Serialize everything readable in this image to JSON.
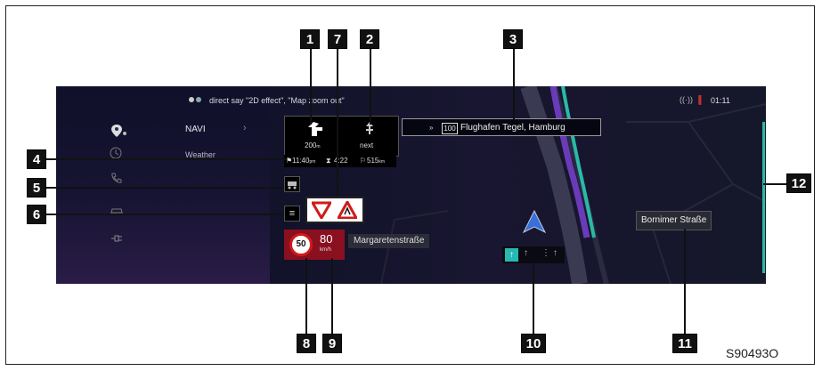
{
  "status": {
    "voice_hint": "direct say \"2D effect\", \"Map zoom out\"",
    "time": "01:11"
  },
  "sidebar": {
    "navi_label": "NAVI",
    "weather_label": "Weather",
    "icons": [
      "map-pin-icon",
      "clock-icon",
      "phone-icon",
      "car-icon",
      "plug-icon"
    ]
  },
  "maneuver": {
    "distance": "200",
    "distance_unit": "m",
    "next_label": "next"
  },
  "destination": {
    "road_badge": "100",
    "text": "Flughafen Tegel, Hamburg"
  },
  "trip": {
    "arrival": "11:40",
    "arrival_suffix": "pm",
    "duration": "4:22",
    "distance": "515",
    "distance_unit": "km"
  },
  "speed": {
    "limit": "50",
    "current": "80",
    "unit": "km/h"
  },
  "current_street": "Margaretenstraße",
  "cross_street": "Bornimer Straße",
  "callouts": [
    "1",
    "2",
    "3",
    "4",
    "5",
    "6",
    "7",
    "8",
    "9",
    "10",
    "11",
    "12"
  ],
  "figure_ref": "S90493O",
  "colors": {
    "route": "#2ab9a8",
    "accent_red": "#8a1020",
    "background": "#12122a"
  }
}
